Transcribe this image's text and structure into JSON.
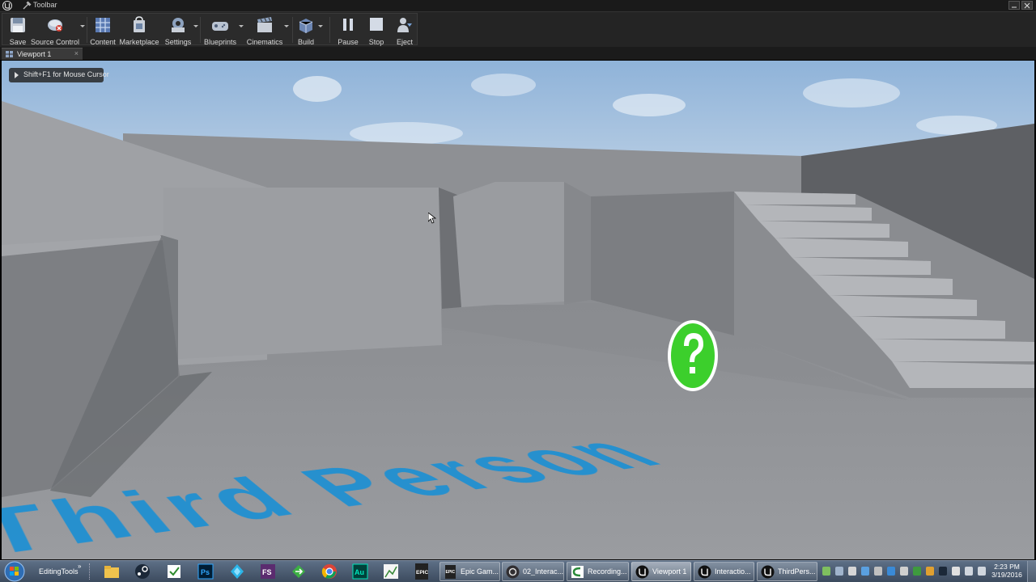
{
  "window": {
    "title": "Toolbar"
  },
  "toolbar": {
    "buttons": [
      {
        "label": "Save",
        "icon": "save-icon"
      },
      {
        "label": "Source Control",
        "icon": "source-control-icon"
      },
      {
        "label": "Content",
        "icon": "content-icon"
      },
      {
        "label": "Marketplace",
        "icon": "marketplace-icon"
      },
      {
        "label": "Settings",
        "icon": "settings-icon"
      },
      {
        "label": "Blueprints",
        "icon": "blueprints-icon"
      },
      {
        "label": "Cinematics",
        "icon": "cinematics-icon"
      },
      {
        "label": "Build",
        "icon": "build-icon"
      },
      {
        "label": "Pause",
        "icon": "pause-icon"
      },
      {
        "label": "Stop",
        "icon": "stop-icon"
      },
      {
        "label": "Eject",
        "icon": "eject-icon"
      }
    ]
  },
  "tab": {
    "label": "Viewport 1",
    "close": "×"
  },
  "viewport": {
    "hint": "Shift+F1 for Mouse Cursor",
    "floor_text": "Third Person",
    "pickup_icon": "question-mark-icon"
  },
  "taskbar": {
    "toolbar_label": "EditingTools",
    "chevron": "»",
    "pinned": [
      "folder-icon",
      "steam-icon",
      "task-icon",
      "photoshop-icon",
      "gem-icon",
      "fs-icon",
      "arrow-icon",
      "chrome-icon",
      "audition-icon",
      "grapher-icon",
      "epic-icon"
    ],
    "pinned_labels": {
      "photoshop": "Ps",
      "fs": "FS",
      "audition": "Au",
      "epic": "EPIC"
    },
    "tasks": [
      {
        "label": "Epic Gam...",
        "icon": "epic-icon"
      },
      {
        "label": "02_Interac...",
        "icon": "obs-icon"
      },
      {
        "label": "Recording...",
        "icon": "camtasia-icon"
      },
      {
        "label": "Viewport 1",
        "icon": "unreal-icon"
      },
      {
        "label": "Interactio...",
        "icon": "unreal-icon"
      },
      {
        "label": "ThirdPers...",
        "icon": "unreal-icon"
      }
    ],
    "clock_time": "2:23 PM",
    "clock_date": "3/19/2016"
  },
  "colors": {
    "floor_text": "#1b8fd3",
    "pickup": "#3ccf2c",
    "sky": "#a8c6e0"
  }
}
